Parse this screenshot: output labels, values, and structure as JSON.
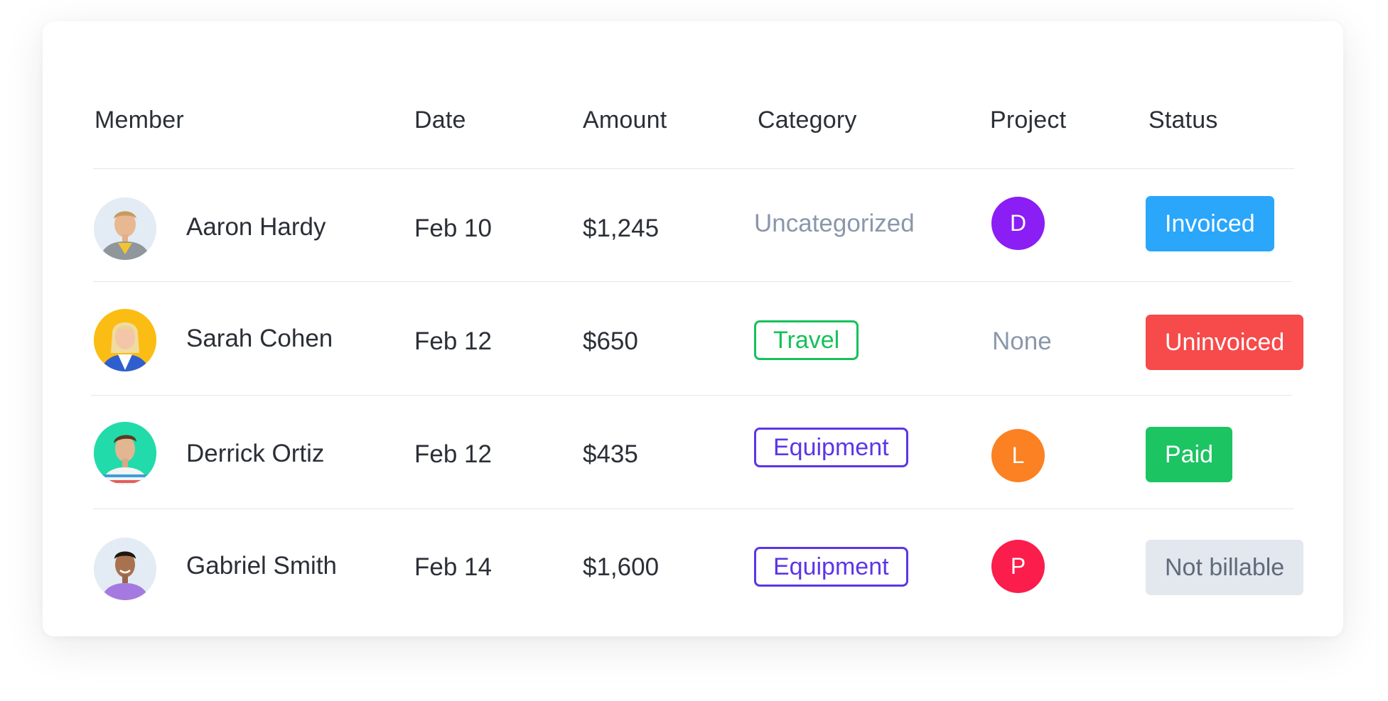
{
  "table": {
    "headers": {
      "member": "Member",
      "date": "Date",
      "amount": "Amount",
      "category": "Category",
      "project": "Project",
      "status": "Status"
    },
    "rows": [
      {
        "member": "Aaron Hardy",
        "date": "Feb 10",
        "amount": "$1,245",
        "category": "Uncategorized",
        "project": "D",
        "status": "Invoiced"
      },
      {
        "member": "Sarah Cohen",
        "date": "Feb 12",
        "amount": "$650",
        "category": "Travel",
        "project": "None",
        "status": "Uninvoiced"
      },
      {
        "member": "Derrick Ortiz",
        "date": "Feb 12",
        "amount": "$435",
        "category": "Equipment",
        "project": "L",
        "status": "Paid"
      },
      {
        "member": "Gabriel Smith",
        "date": "Feb 14",
        "amount": "$1,600",
        "category": "Equipment",
        "project": "P",
        "status": "Not billable"
      }
    ]
  },
  "colors": {
    "project_d": "#8b1df5",
    "project_l": "#fb8122",
    "project_p": "#fb1d4c",
    "status_invoiced": "#2aa6fb",
    "status_uninvoiced": "#f74a4a",
    "status_paid": "#1cc462",
    "status_not_billable": "#e3e7ee",
    "category_travel": "#16c05a",
    "category_equipment": "#5b36e8",
    "muted_text": "#8a97ab"
  },
  "icons": {
    "avatars": [
      "avatar-photo-aaron-hardy",
      "avatar-photo-sarah-cohen",
      "avatar-photo-derrick-ortiz",
      "avatar-photo-gabriel-smith"
    ]
  }
}
